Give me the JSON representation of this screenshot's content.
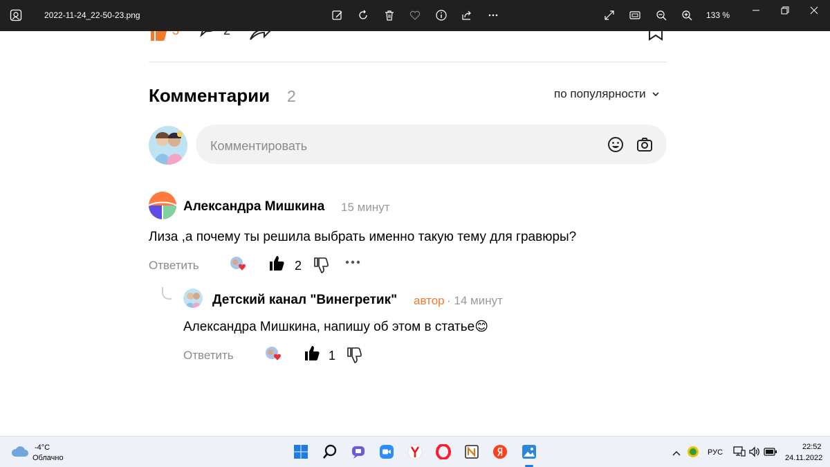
{
  "window": {
    "filename": "2022-11-24_22-50-23.png",
    "zoom": "133 %"
  },
  "post": {
    "likes": "3",
    "comments": "2"
  },
  "comments_section": {
    "title": "Комментарии",
    "count": "2",
    "sort_label": "по популярности",
    "input_placeholder": "Комментировать"
  },
  "comments": [
    {
      "author": "Александра Мишкина",
      "time": "15 минут",
      "text": "Лиза ,а почему ты решила выбрать именно такую тему для гравюры?",
      "reply_label": "Ответить",
      "likes": "2"
    },
    {
      "author": "Детский канал \"Винегретик\"",
      "badge": "автор",
      "time": "· 14 минут",
      "text": "Александра Мишкина, напишу об этом в статье😊",
      "reply_label": "Ответить",
      "likes": "1"
    }
  ],
  "taskbar": {
    "weather_temp": "-4°C",
    "weather_desc": "Облачно",
    "lang": "РУС",
    "time": "22:52",
    "date": "24.11.2022"
  },
  "colors": {
    "accent_orange": "#f37a2b",
    "title_bar": "#202020"
  }
}
